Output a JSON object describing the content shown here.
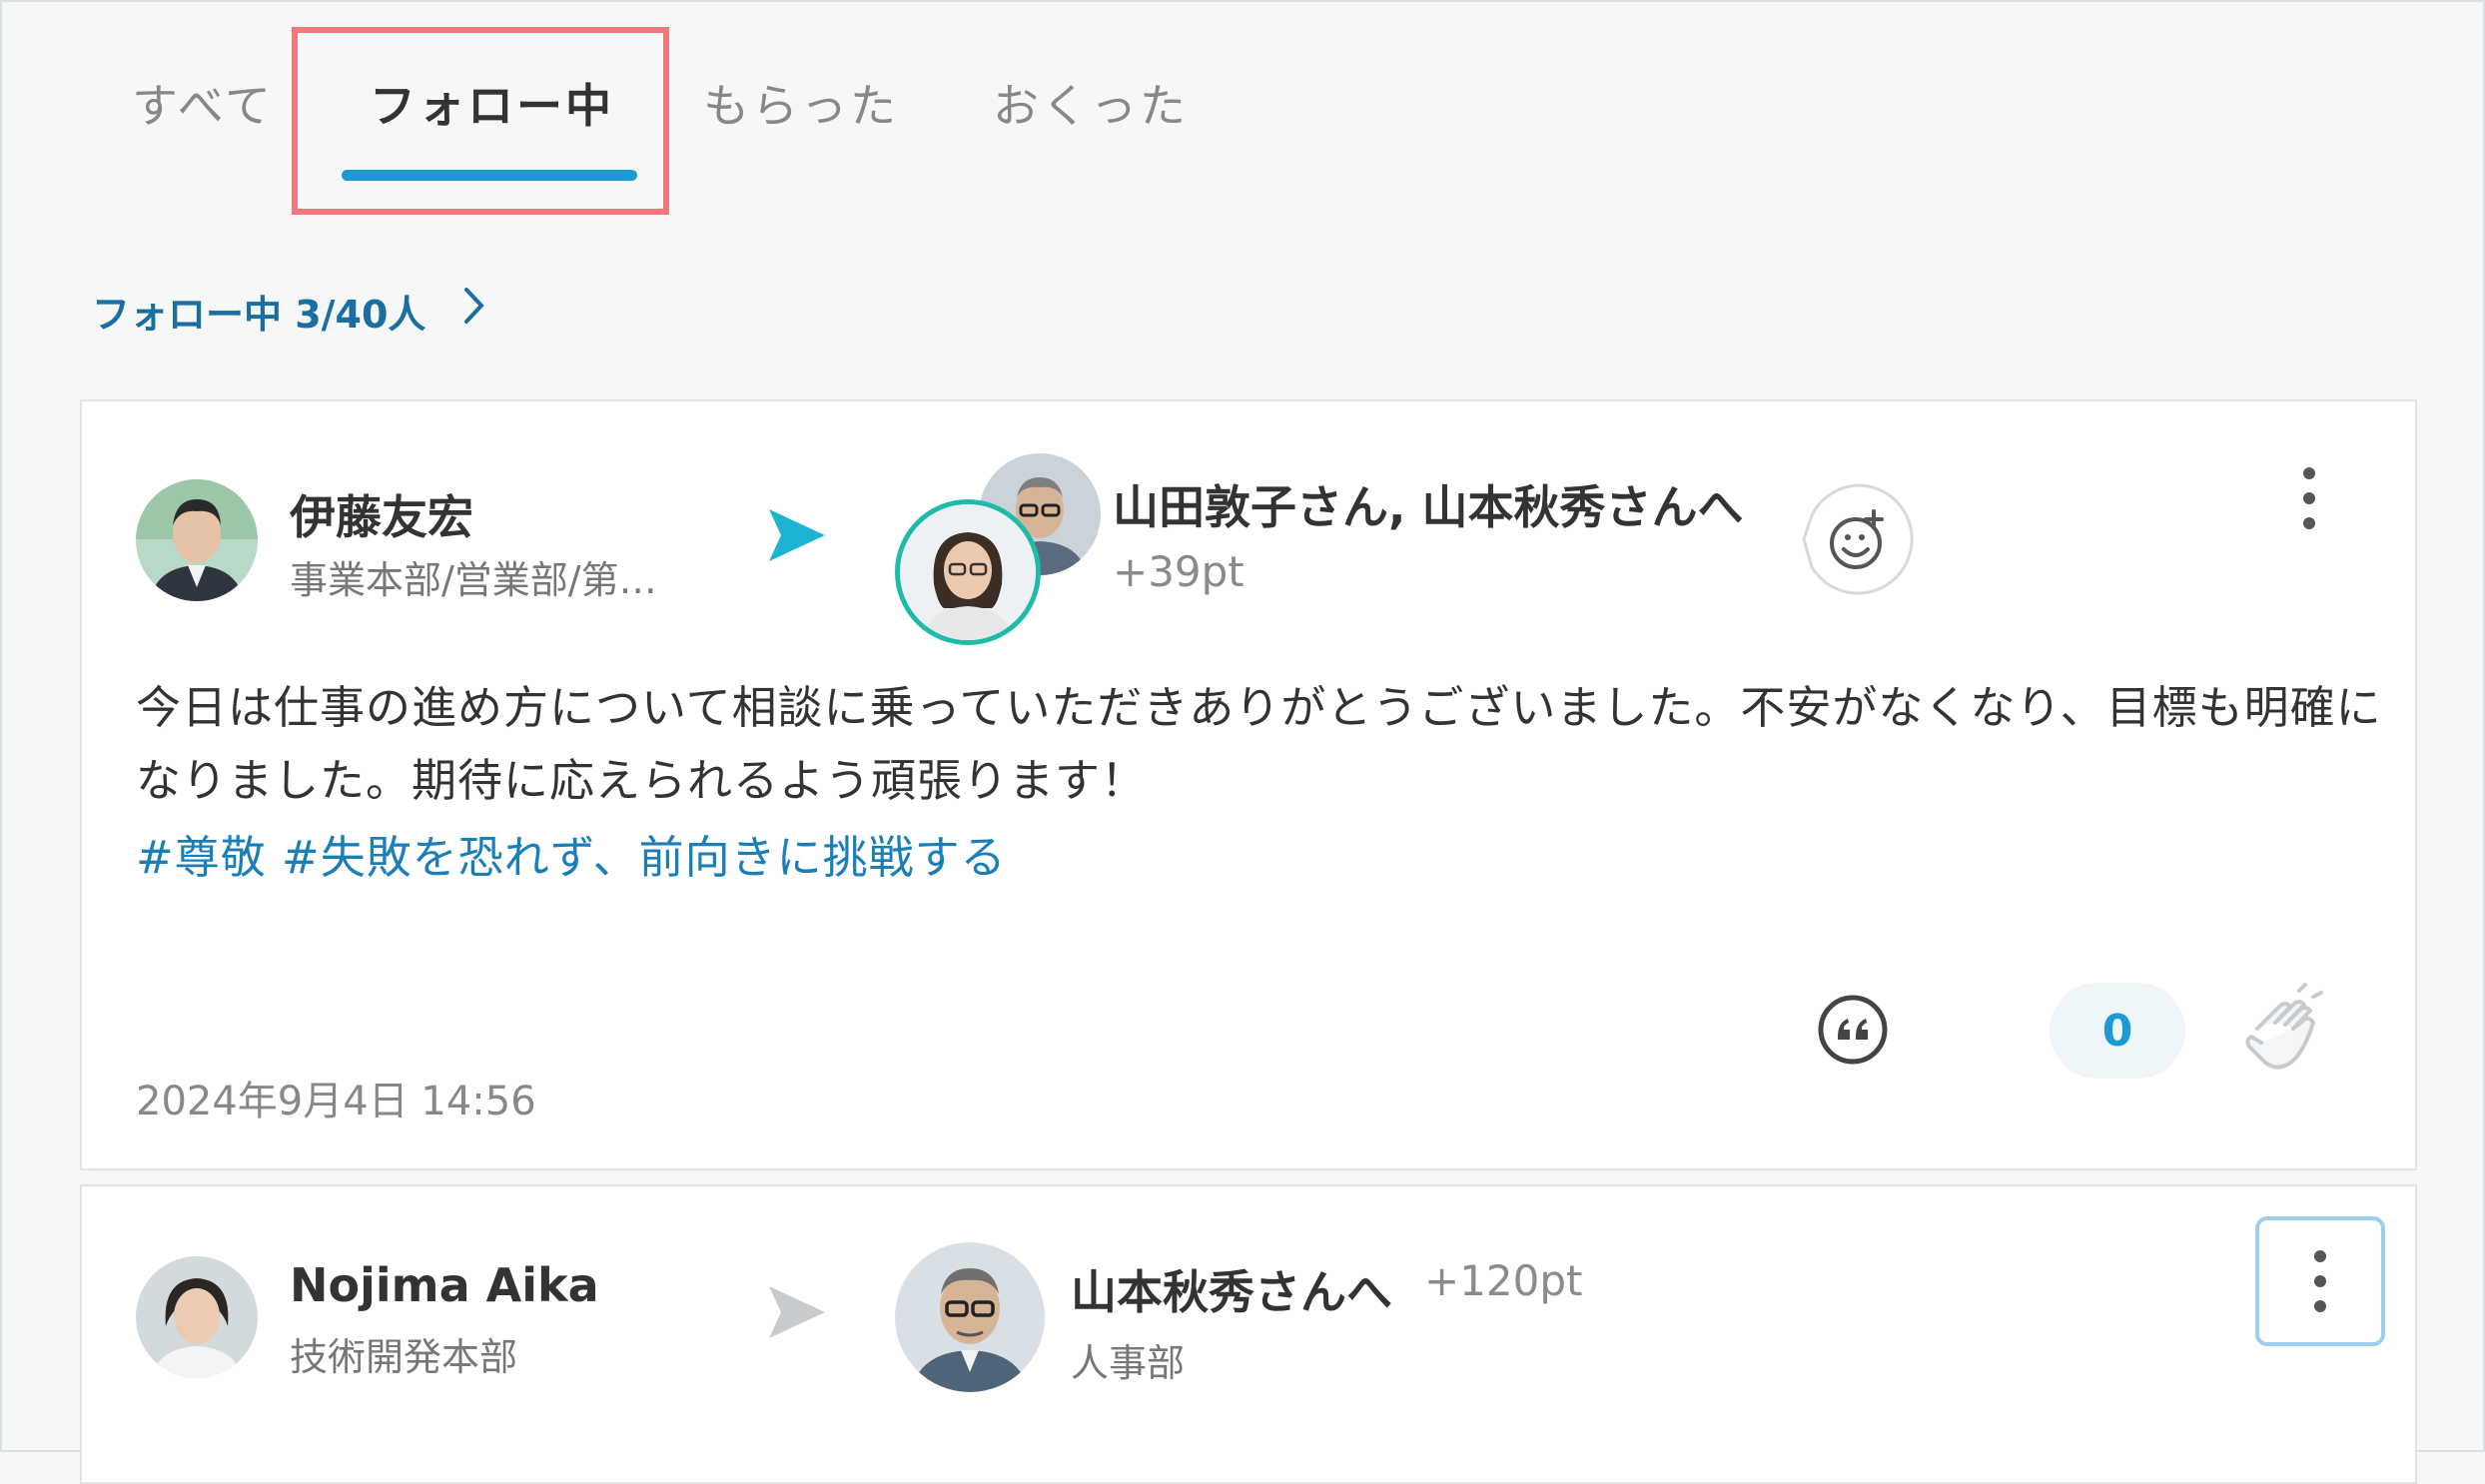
{
  "tabs": [
    {
      "label": "すべて",
      "active": false
    },
    {
      "label": "フォロー中",
      "active": true
    },
    {
      "label": "もらった",
      "active": false
    },
    {
      "label": "おくった",
      "active": false
    }
  ],
  "follow_summary": {
    "label": "フォロー中 3/40人"
  },
  "accent_color": "#1d9ad6",
  "highlight_color": "#f0787c",
  "posts": [
    {
      "sender": {
        "name": "伊藤友宏",
        "dept": "事業本部/営業部/第…"
      },
      "recipients_text": "山田敦子さん, 山本秋秀さんへ",
      "points": "+39pt",
      "message": "今日は仕事の進め方について相談に乗っていただきありがとうございました。不安がなくなり、目標も明確になりました。期待に応えられるよう頑張ります！",
      "tags": "#尊敬 #失敗を恐れず、前向きに挑戦する",
      "date": "2024年9月4日 14:56",
      "clap_count": "0"
    },
    {
      "sender": {
        "name": "Nojima Aika",
        "dept": "技術開発本部"
      },
      "recipients_text": "山本秋秀さんへ",
      "points": "+120pt",
      "recipient_dept": "人事部"
    }
  ],
  "icons": {
    "send_arrow": "send-arrow-icon",
    "add_reaction": "smiley-plus-icon",
    "more": "kebab-icon",
    "quote": "quote-icon",
    "clap": "clap-icon",
    "chevron": "chevron-right-icon"
  }
}
